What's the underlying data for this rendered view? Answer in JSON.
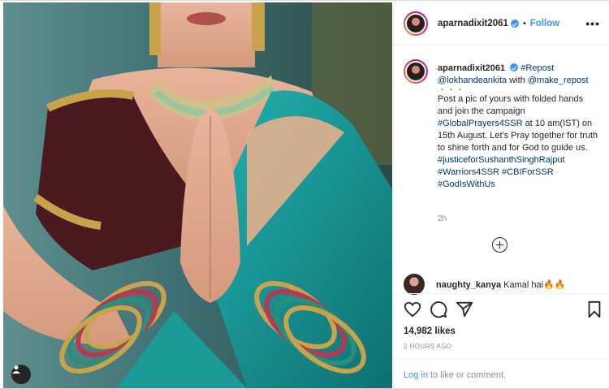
{
  "post": {
    "username": "aparnadixit2061",
    "follow_label": "Follow",
    "separator": "•",
    "more_label": "•••"
  },
  "caption": {
    "username": "aparnadixit2061",
    "repost_tag": "#Repost",
    "credit_user": "@lokhandeankita",
    "with_text": "with",
    "repost_app": "@make_repost",
    "ellipsis": "・・・",
    "body": "Post a pic of yours with folded hands and join the campaign",
    "hashtag_campaign": "#GlobalPrayers4SSR",
    "body2": "at 10 am(IST) on 15th August. Let's Pray together for truth to shine forth and for God to guide us.",
    "hashtags": [
      "#justiceforSushanthSinghRajput",
      "#Warriors4SSR",
      "#CBIForSSR",
      "#GodIsWithUs"
    ],
    "time": "2h"
  },
  "comment": {
    "username": "naughty_kanya",
    "text": "Kamal hai",
    "emoji": "🔥🔥"
  },
  "stats": {
    "likes": "14,982 likes",
    "posted": "2 HOURS AGO"
  },
  "footer": {
    "login_link": "Log in",
    "login_rest": "to like or comment."
  },
  "icons": {
    "like": "heart-icon",
    "comment": "comment-icon",
    "share": "share-icon",
    "save": "bookmark-icon",
    "add_comment": "plus-icon",
    "user_tag": "user-tag-icon",
    "verified": "verified-badge-icon"
  },
  "colors": {
    "link_blue": "#3897f0",
    "hashtag_blue": "#00376b",
    "muted": "#8e8e8e",
    "text": "#262626"
  }
}
